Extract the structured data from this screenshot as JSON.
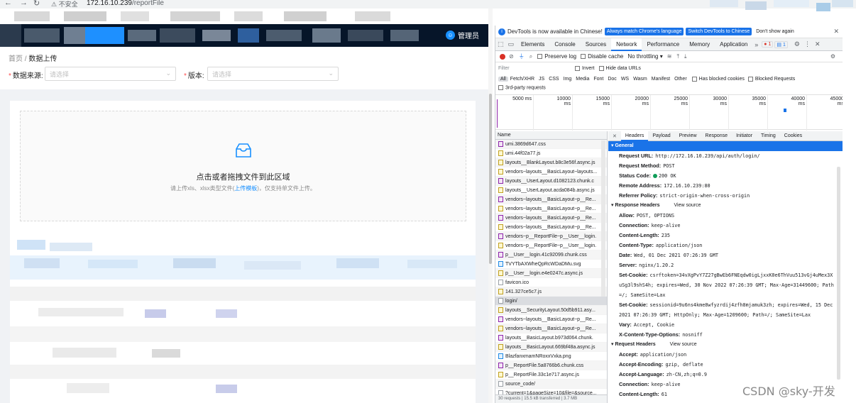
{
  "browser": {
    "security_label": "不安全",
    "url_host": "172.16.10.239",
    "url_path": "/reportFile"
  },
  "app": {
    "header_user": "管理员",
    "breadcrumb": [
      "首页",
      "数据上传"
    ],
    "form": {
      "source_label": "数据来源:",
      "source_placeholder": "请选择",
      "version_label": "版本:",
      "version_placeholder": "请选择"
    },
    "upload": {
      "title": "点击或者拖拽文件到此区域",
      "hint_before": "请上传xls、xlsx类型文件(",
      "hint_link": "上传模板",
      "hint_after": ")，仅支持单文件上传。"
    }
  },
  "devtools": {
    "infobar": {
      "message": "DevTools is now available in Chinese!",
      "btn_match": "Always match Chrome's language",
      "btn_switch": "Switch DevTools to Chinese",
      "btn_dismiss": "Don't show again"
    },
    "tabs": [
      "Elements",
      "Console",
      "Sources",
      "Network",
      "Performance",
      "Memory",
      "Application"
    ],
    "active_tab": "Network",
    "error_count": "1",
    "message_count": "1",
    "toolbar": {
      "preserve_log": "Preserve log",
      "disable_cache": "Disable cache",
      "throttling": "No throttling"
    },
    "filter": {
      "placeholder": "Filter",
      "invert": "Invert",
      "hide_data_urls": "Hide data URLs"
    },
    "types": [
      "All",
      "Fetch/XHR",
      "JS",
      "CSS",
      "Img",
      "Media",
      "Font",
      "Doc",
      "WS",
      "Wasm",
      "Manifest",
      "Other"
    ],
    "has_blocked_cookies": "Has blocked cookies",
    "blocked_requests": "Blocked Requests",
    "third_party": "3rd-party requests",
    "timeline_ticks": [
      "5000 ms",
      "10000 ms",
      "15000 ms",
      "20000 ms",
      "25000 ms",
      "30000 ms",
      "35000 ms",
      "40000 ms",
      "45000 ms"
    ],
    "name_header": "Name",
    "requests": [
      {
        "name": "umi.3869d647.css",
        "type": "css"
      },
      {
        "name": "umi.44f02a77.js",
        "type": "js"
      },
      {
        "name": "layouts__BlankLayout.b8c3e56f.async.js",
        "type": "js"
      },
      {
        "name": "vendors~layouts__BasicLayout~layouts...",
        "type": "js"
      },
      {
        "name": "layouts__UserLayout.d1082123.chunk.c",
        "type": "css"
      },
      {
        "name": "layouts__UserLayout.acda084b.async.js",
        "type": "js"
      },
      {
        "name": "vendors~layouts__BasicLayout~p__Re...",
        "type": "css"
      },
      {
        "name": "vendors~layouts__BasicLayout~p__Re...",
        "type": "js"
      },
      {
        "name": "vendors~layouts__BasicLayout~p__Re...",
        "type": "css"
      },
      {
        "name": "vendors~layouts__BasicLayout~p__Re...",
        "type": "js"
      },
      {
        "name": "vendors~p__ReportFile~p__User__login.",
        "type": "css"
      },
      {
        "name": "vendors~p__ReportFile~p__User__login.",
        "type": "js"
      },
      {
        "name": "p__User__login.41c92099.chunk.css",
        "type": "css"
      },
      {
        "name": "TVYTbAXWheQpRcWDaDMu.svg",
        "type": "img"
      },
      {
        "name": "p__User__login.e4e0247c.async.js",
        "type": "js"
      },
      {
        "name": "favicon.ico",
        "type": "doc"
      },
      {
        "name": "141.327ce5c7.js",
        "type": "js"
      },
      {
        "name": "login/",
        "type": "doc"
      },
      {
        "name": "layouts__SecurityLayout.50d5b911.asy...",
        "type": "js"
      },
      {
        "name": "vendors~layouts__BasicLayout~p__Re...",
        "type": "css"
      },
      {
        "name": "vendors~layouts__BasicLayout~p__Re...",
        "type": "js"
      },
      {
        "name": "layouts__BasicLayout.b973d064.chunk.",
        "type": "css"
      },
      {
        "name": "layouts__BasicLayout.669bf48a.async.js",
        "type": "js"
      },
      {
        "name": "BlazfanxmamNRoxxVxka.png",
        "type": "img"
      },
      {
        "name": "p__ReportFile.5a8766b6.chunk.css",
        "type": "css"
      },
      {
        "name": "p__ReportFile.33c1e717.async.js",
        "type": "js"
      },
      {
        "name": "source_code/",
        "type": "doc"
      },
      {
        "name": "?current=1&pageSize=10&file=&source...",
        "type": "doc"
      }
    ],
    "selected_request": "login/",
    "status_summary": "30 requests  |  15.5 kB transferred  |  3.7 MB",
    "detail_tabs": [
      "Headers",
      "Payload",
      "Preview",
      "Response",
      "Initiator",
      "Timing",
      "Cookies"
    ],
    "active_detail_tab": "Headers",
    "general_title": "General",
    "general": [
      {
        "k": "Request URL:",
        "v": "http://172.16.10.239/api/auth/login/"
      },
      {
        "k": "Request Method:",
        "v": "POST"
      },
      {
        "k": "Status Code:",
        "v": "200 OK"
      },
      {
        "k": "Remote Address:",
        "v": "172.16.10.239:80"
      },
      {
        "k": "Referrer Policy:",
        "v": "strict-origin-when-cross-origin"
      }
    ],
    "response_headers_title": "Response Headers",
    "view_source": "View source",
    "response_headers": [
      {
        "k": "Allow:",
        "v": "POST, OPTIONS"
      },
      {
        "k": "Connection:",
        "v": "keep-alive"
      },
      {
        "k": "Content-Length:",
        "v": "235"
      },
      {
        "k": "Content-Type:",
        "v": "application/json"
      },
      {
        "k": "Date:",
        "v": "Wed, 01 Dec 2021 07:26:39 GMT"
      },
      {
        "k": "Server:",
        "v": "nginx/1.20.2"
      },
      {
        "k": "Set-Cookie:",
        "v": "csrftoken=34vXgPvY7Z27gBwEb6FNEqdw0igLjxxK0e6ThVuu513vGj4uMex3XuSg3l9shS4h; expires=Wed, 30 Nov 2022 07:26:39 GMT; Max-Age=31449600; Path=/; SameSite=Lax"
      },
      {
        "k": "Set-Cookie:",
        "v": "sessionid=9u6ns4kme8wfyzrdij4zfh8mjamuk3zh; expires=Wed, 15 Dec 2021 07:26:39 GMT; HttpOnly; Max-Age=1209600; Path=/; SameSite=Lax"
      },
      {
        "k": "Vary:",
        "v": "Accept, Cookie"
      },
      {
        "k": "X-Content-Type-Options:",
        "v": "nosniff"
      }
    ],
    "request_headers_title": "Request Headers",
    "request_headers": [
      {
        "k": "Accept:",
        "v": "application/json"
      },
      {
        "k": "Accept-Encoding:",
        "v": "gzip, deflate"
      },
      {
        "k": "Accept-Language:",
        "v": "zh-CN,zh;q=0.9"
      },
      {
        "k": "Connection:",
        "v": "keep-alive"
      },
      {
        "k": "Content-Length:",
        "v": "61"
      }
    ]
  },
  "watermark": "CSDN @sky-开发",
  "colors": {
    "header_bg": "#061529",
    "primary": "#1890ff",
    "devtools_blue": "#1a73e8"
  }
}
